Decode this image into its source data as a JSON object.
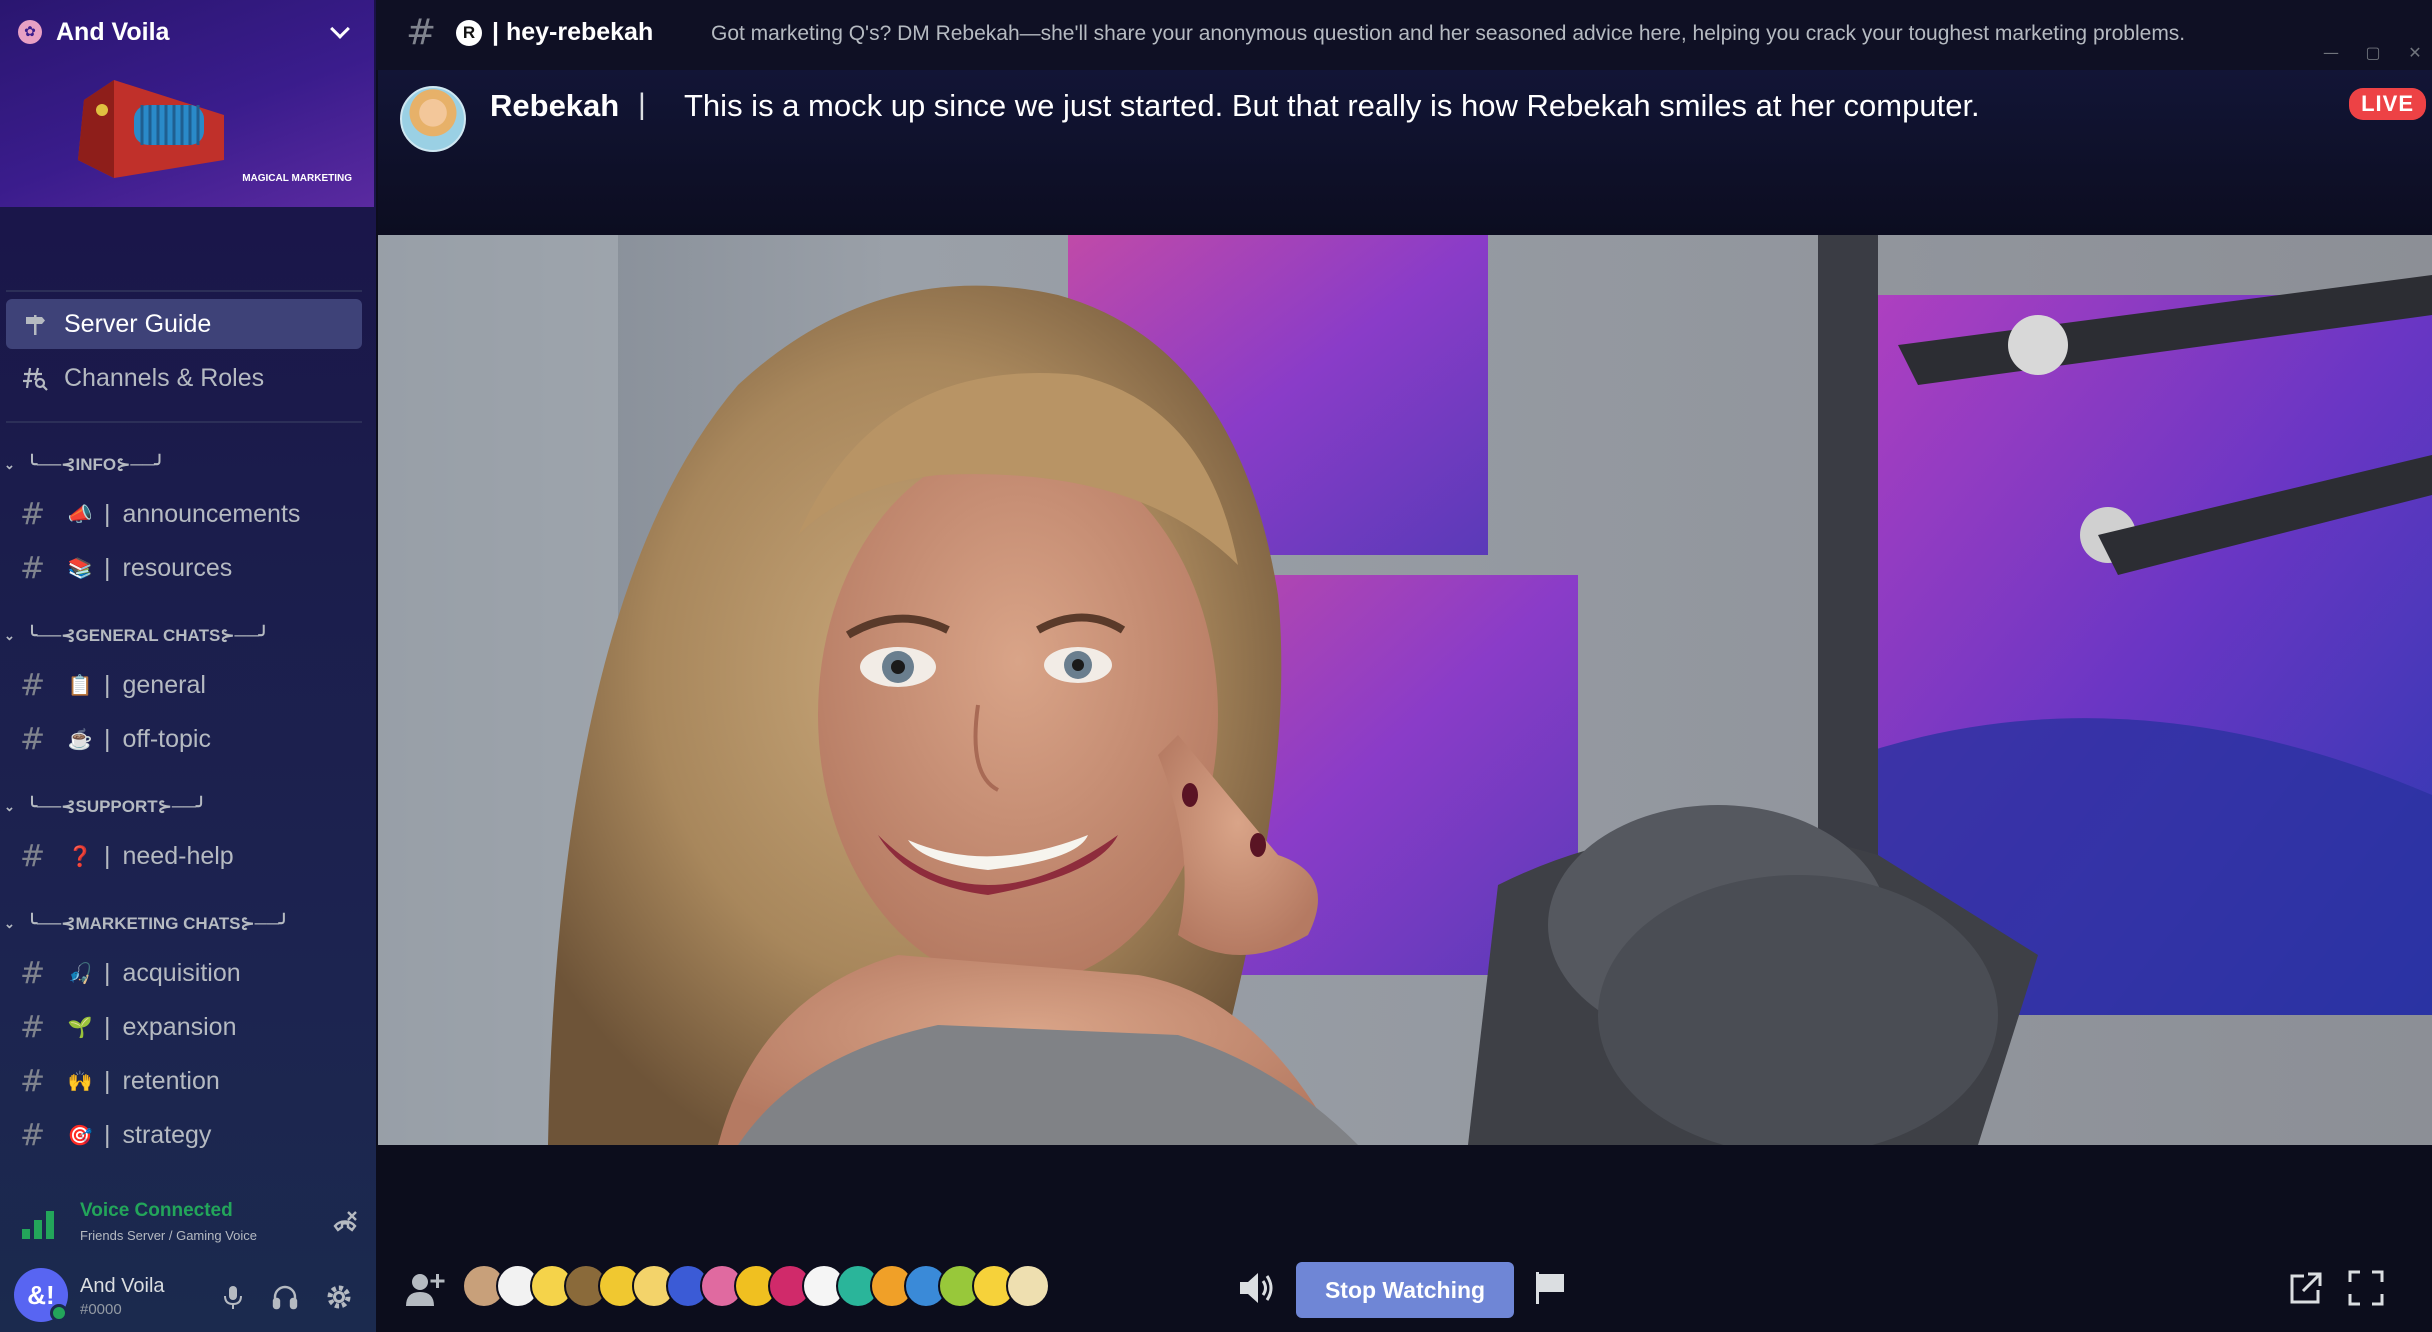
{
  "server": {
    "name": "And Voila",
    "banner_caption": "MAGICAL MARKETING"
  },
  "nav": {
    "server_guide": "Server Guide",
    "channels_roles": "Channels & Roles"
  },
  "categories": [
    {
      "label": "╰──⊰INFO⊱──╯",
      "channels": [
        {
          "emoji": "📣",
          "name": "announcements"
        },
        {
          "emoji": "📚",
          "name": "resources"
        }
      ]
    },
    {
      "label": "╰──⊰GENERAL CHATS⊱──╯",
      "channels": [
        {
          "emoji": "📋",
          "name": "general"
        },
        {
          "emoji": "☕",
          "name": "off-topic"
        }
      ]
    },
    {
      "label": "╰──⊰SUPPORT⊱──╯",
      "channels": [
        {
          "emoji": "❓",
          "name": "need-help"
        }
      ]
    },
    {
      "label": "╰──⊰MARKETING CHATS⊱──╯",
      "channels": [
        {
          "emoji": "🎣",
          "name": "acquisition"
        },
        {
          "emoji": "🌱",
          "name": "expansion"
        },
        {
          "emoji": "🙌",
          "name": "retention"
        },
        {
          "emoji": "🎯",
          "name": "strategy"
        }
      ]
    }
  ],
  "voice": {
    "status": "Voice Connected",
    "location": "Friends Server / Gaming Voice"
  },
  "user": {
    "name": "And Voila",
    "tag": "#0000",
    "avatar_text": "&!"
  },
  "topbar": {
    "badge": "R",
    "channel": "| hey-rebekah",
    "topic": "Got marketing Q's? DM Rebekah—she'll share your anonymous question and her seasoned advice here, helping you crack your toughest marketing problems."
  },
  "stream": {
    "streamer": "Rebekah",
    "separator": "|",
    "message": "This is a mock up since we just started. But that really is how Rebekah smiles at her computer.",
    "live_label": "LIVE",
    "stop_button": "Stop Watching"
  },
  "viewer_colors": [
    "#c8a07a",
    "#f2f2f2",
    "#f5d34a",
    "#8a6a3a",
    "#f0c830",
    "#f3d36a",
    "#3b5bd6",
    "#e06aa0",
    "#f0c020",
    "#d02a6a",
    "#f5f5f5",
    "#2ab59a",
    "#f0a028",
    "#3a8ad8",
    "#98c83a",
    "#f6d23a",
    "#eedfb0"
  ],
  "colors": {
    "accent_button": "#6f86d6",
    "live_red": "#ed4245",
    "voice_green": "#23a55a"
  }
}
